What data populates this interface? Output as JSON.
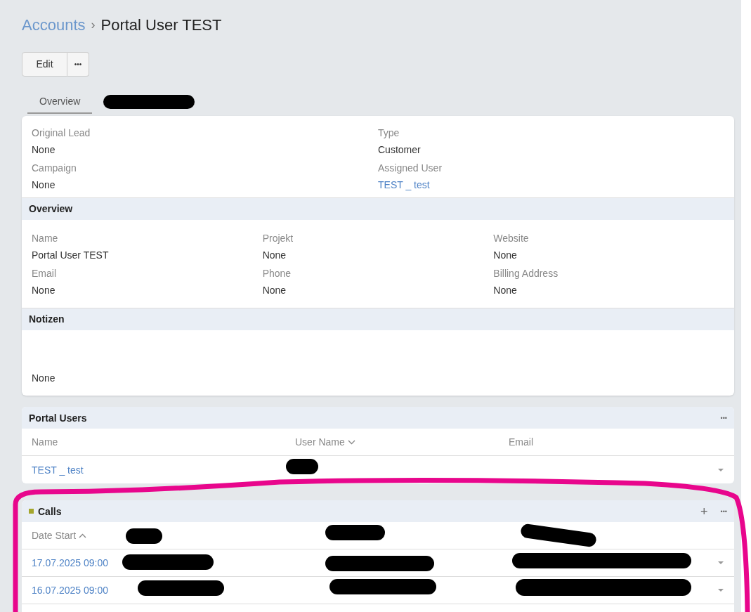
{
  "breadcrumb": {
    "parent": "Accounts",
    "separator": "›",
    "current": "Portal User TEST"
  },
  "actions": {
    "edit": "Edit",
    "more": "•••"
  },
  "tabs": [
    {
      "label": "Overview",
      "selected": true
    }
  ],
  "top_fields": [
    {
      "label": "Original Lead",
      "value": "None",
      "link": false
    },
    {
      "label": "Type",
      "value": "Customer",
      "link": false
    },
    {
      "label": "Campaign",
      "value": "None",
      "link": false
    },
    {
      "label": "Assigned User",
      "value": "TEST _ test",
      "link": true
    }
  ],
  "sections": [
    {
      "title": "Overview",
      "fields": [
        {
          "label": "Name",
          "value": "Portal User TEST"
        },
        {
          "label": "Projekt",
          "value": "None"
        },
        {
          "label": "Website",
          "value": "None"
        },
        {
          "label": "Email",
          "value": "None"
        },
        {
          "label": "Phone",
          "value": "None"
        },
        {
          "label": "Billing Address",
          "value": "None"
        }
      ]
    },
    {
      "title": "Notizen",
      "fields": [
        {
          "value": "None"
        }
      ]
    }
  ],
  "portal_users": {
    "title": "Portal Users",
    "menu": "•••",
    "columns": [
      {
        "label": "Name",
        "sorted": false
      },
      {
        "label": "User Name",
        "sorted": true,
        "ascending": false
      },
      {
        "label": "Email",
        "sorted": false
      }
    ],
    "rows": [
      {
        "name": "TEST _ test"
      }
    ]
  },
  "calls": {
    "title": "Calls",
    "color": "#a4a62c",
    "add": "+",
    "menu": "•••",
    "columns": [
      {
        "label": "Date Start",
        "sorted": true,
        "ascending": true
      }
    ],
    "rows": [
      {
        "date": "17.07.2025 09:00"
      },
      {
        "date": "16.07.2025 09:00"
      }
    ]
  }
}
